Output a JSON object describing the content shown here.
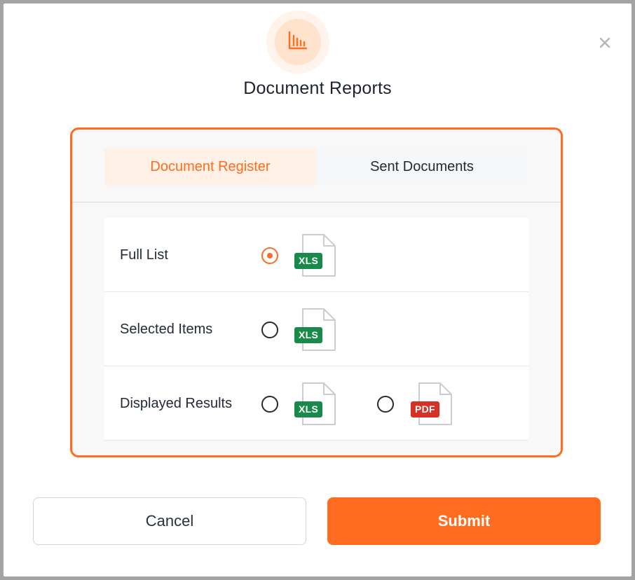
{
  "dialog": {
    "title": "Document Reports",
    "close_icon": "close-icon",
    "header_icon": "bar-chart-icon"
  },
  "tabs": [
    {
      "label": "Document Register",
      "active": true
    },
    {
      "label": "Sent Documents",
      "active": false
    }
  ],
  "options": [
    {
      "label": "Full List",
      "formats": [
        {
          "type": "XLS",
          "selected": true
        }
      ]
    },
    {
      "label": "Selected Items",
      "formats": [
        {
          "type": "XLS",
          "selected": false
        }
      ]
    },
    {
      "label": "Displayed Results",
      "formats": [
        {
          "type": "XLS",
          "selected": false
        },
        {
          "type": "PDF",
          "selected": false
        }
      ]
    }
  ],
  "buttons": {
    "cancel": "Cancel",
    "submit": "Submit"
  },
  "colors": {
    "accent": "#ff6b1f",
    "xls": "#1a8a4a",
    "pdf": "#d93025"
  }
}
